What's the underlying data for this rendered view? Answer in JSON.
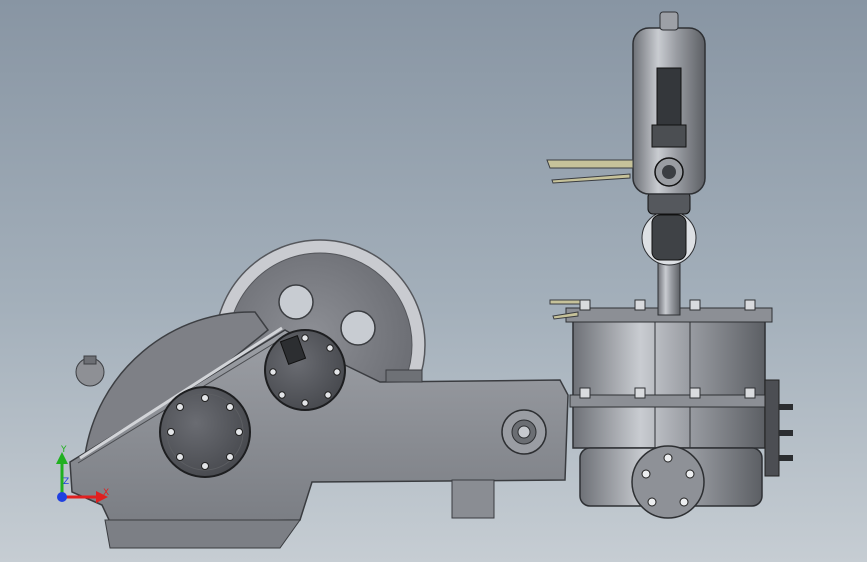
{
  "viewport": {
    "background_top": "#8895a3",
    "background_bottom": "#c6cdd3"
  },
  "model": {
    "body_color": "#8f9298",
    "dark_color": "#3a3c40",
    "highlight_color": "#c8cbd0"
  },
  "triad": {
    "x_label": "X",
    "y_label": "Y",
    "z_label": "Z",
    "x_color": "#e02020",
    "y_color": "#20b020",
    "z_color": "#2040e0"
  }
}
